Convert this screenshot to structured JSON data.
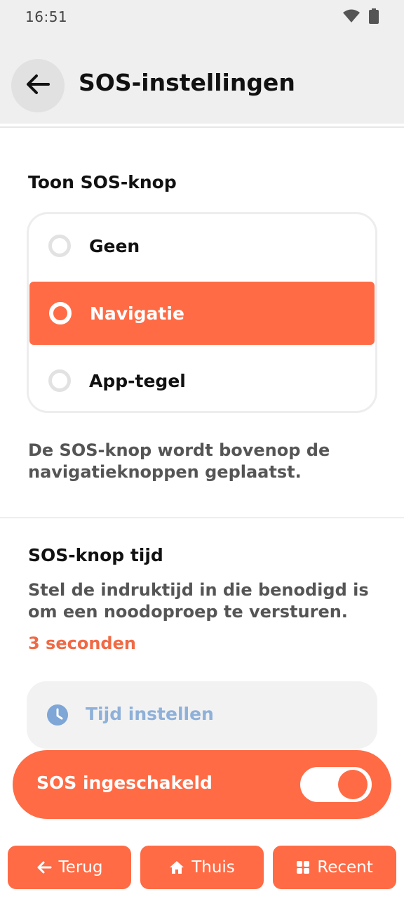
{
  "status_bar": {
    "time": "16:51"
  },
  "header": {
    "title": "SOS-instellingen"
  },
  "show_sos": {
    "title": "Toon SOS-knop",
    "options": [
      {
        "label": "Geen",
        "selected": false
      },
      {
        "label": "Navigatie",
        "selected": true
      },
      {
        "label": "App-tegel",
        "selected": false
      }
    ],
    "description_line1": "De SOS-knop wordt bovenop de",
    "description_line2": "navigatieknoppen geplaatst."
  },
  "sos_time": {
    "title": "SOS-knop tijd",
    "description_line1": "Stel de indruktijd in die benodigd is",
    "description_line2": "om een noodoproep te versturen.",
    "value": "3 seconden",
    "set_time_label": "Tijd instellen"
  },
  "sos_enabled": {
    "label": "SOS ingeschakeld",
    "on": true
  },
  "bottom_nav": {
    "back": "Terug",
    "home": "Thuis",
    "recent": "Recent"
  },
  "colors": {
    "accent": "#ff6b45",
    "header_bg": "#efefef",
    "disabled_text": "#8fb0d8"
  },
  "icons": {
    "back": "arrow-left-icon",
    "wifi": "wifi-icon",
    "battery": "battery-icon",
    "clock": "clock-icon",
    "home": "home-icon",
    "recent": "grid-icon"
  }
}
